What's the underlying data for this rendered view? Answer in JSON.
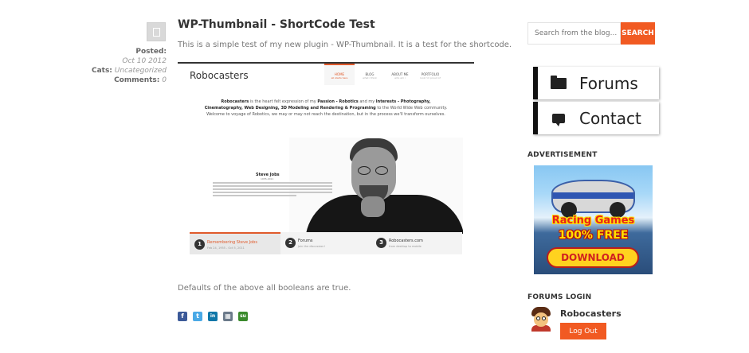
{
  "post": {
    "title": "WP-Thumbnail - ShortCode Test",
    "intro": "This is a simple test of my new plugin - WP-Thumbnail. It is a test for the shortcode.",
    "footer_text": "Defaults of the above all booleans are true.",
    "meta": {
      "posted_label": "Posted:",
      "date": "Oct 10 2012",
      "cats_label": "Cats:",
      "category": "Uncategorized",
      "comments_label": "Comments:",
      "comments_count": "0"
    }
  },
  "thumbnail": {
    "brand": "Robocasters",
    "nav": [
      {
        "label": "HOME",
        "sub": "all starts here",
        "active": true
      },
      {
        "label": "BLOG",
        "sub": "what i think",
        "active": false
      },
      {
        "label": "ABOUT ME",
        "sub": "who am i",
        "active": false
      },
      {
        "label": "PORTFOLIO",
        "sub": "look i'm proud of",
        "active": false
      }
    ],
    "para_bold1": "Robocasters",
    "para_t1": " is the heart felt expression of my ",
    "para_bold2": "Passion - Robotics",
    "para_t2": " and my ",
    "para_bold3": "Interests - Photography, Cinematography, Web Designing, 3D Modeling and Rendering & Programing",
    "para_t3": " to the World Wide Web community. Welcome to voyage of Robotics, we may or may not reach the destination, but in the process we'll transform ourselves.",
    "quote_name": "Steve Jobs",
    "quote_years": "1955-2011",
    "tabs": [
      {
        "num": "1",
        "title": "Remembering Steve Jobs",
        "sub": "Feb 24, 1955 - Oct 5, 2011",
        "active": true
      },
      {
        "num": "2",
        "title": "Forums",
        "sub": "Join the discussion!",
        "active": false
      },
      {
        "num": "3",
        "title": "Robocasters.com",
        "sub": "from desktop to mobile",
        "active": false
      }
    ]
  },
  "share_icons": [
    {
      "name": "facebook-icon",
      "glyph": "f",
      "color": "#3b5998"
    },
    {
      "name": "twitter-icon",
      "glyph": "t",
      "color": "#4aa9e6"
    },
    {
      "name": "linkedin-icon",
      "glyph": "in",
      "color": "#0e76a8"
    },
    {
      "name": "delicious-icon",
      "glyph": "▦",
      "color": "#6b7a8a"
    },
    {
      "name": "stumbleupon-icon",
      "glyph": "su",
      "color": "#3a8a2c"
    }
  ],
  "sidebar": {
    "search_placeholder": "Search from the blog...",
    "search_button": "SEARCH",
    "forums_button": "Forums",
    "contact_button": "Contact",
    "advertisement_heading": "ADVERTISEMENT",
    "ad": {
      "line1": "Racing Games",
      "line2": "100% FREE",
      "cta": "DOWNLOAD"
    },
    "forums_login_heading": "FORUMS LOGIN",
    "username": "Robocasters",
    "logout_label": "Log Out"
  },
  "colors": {
    "accent": "#f15a22",
    "text": "#333333",
    "muted": "#777777"
  }
}
